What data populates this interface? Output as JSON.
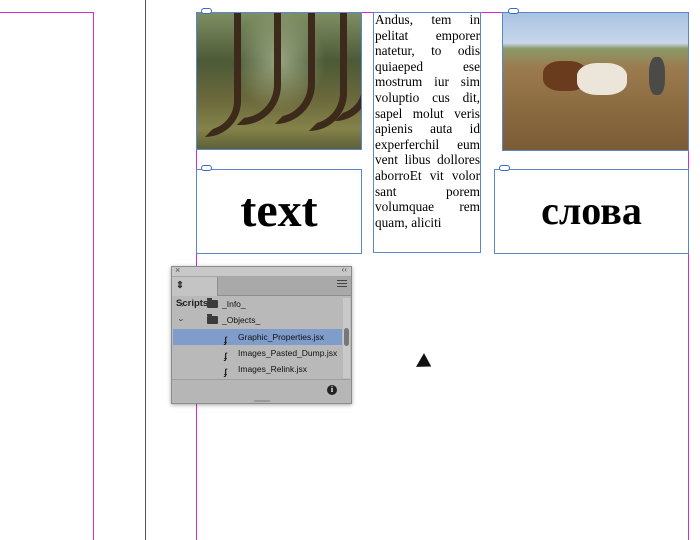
{
  "layout_frames": {
    "left_frame_word": "text",
    "right_frame_word": "слова",
    "body_text": "Andus, tem in pelitat emporer natetur, to odis quiaeped ese mostrum iur sim voluptio cus dit, sapel molut veris apienis auta id experferchil eum vent libus dollores aborroEt vit volor sant porem volumquae rem quam, aliciti"
  },
  "images": {
    "left": "photo of curved pine forest",
    "right": "photo of horses plowing a field"
  },
  "scripts_panel": {
    "tab_label": "Scripts",
    "items": [
      {
        "label": "_Info_",
        "type": "folder",
        "expanded": false
      },
      {
        "label": "_Objects_",
        "type": "folder",
        "expanded": true
      },
      {
        "label": "Graphic_Properties.jsx",
        "type": "script",
        "selected": true
      },
      {
        "label": "Images_Pasted_Dump.jsx",
        "type": "script",
        "selected": false
      },
      {
        "label": "Images_Relink.jsx",
        "type": "script",
        "selected": false
      }
    ],
    "icons": {
      "close": "close-icon",
      "collapse": "collapse-icon",
      "menu": "panel-menu-icon",
      "info": "info-icon"
    }
  },
  "colors": {
    "guide": "#d42bd4",
    "frame_border": "#5b86c9",
    "selection": "#7f9ccb"
  }
}
